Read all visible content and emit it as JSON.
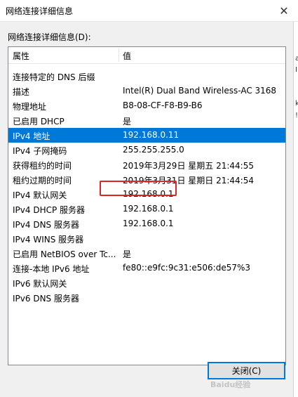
{
  "window": {
    "title": "网络连接详细信息",
    "close_glyph": "✕"
  },
  "section_label": "网络连接详细信息(D):",
  "table": {
    "columns": [
      "属性",
      "值"
    ],
    "rows": [
      {
        "property": "连接特定的 DNS 后缀",
        "value": ""
      },
      {
        "property": "描述",
        "value": "Intel(R) Dual Band Wireless-AC 3168"
      },
      {
        "property": "物理地址",
        "value": "B8-08-CF-F8-B9-B6"
      },
      {
        "property": "已启用 DHCP",
        "value": "是"
      },
      {
        "property": "IPv4 地址",
        "value": "192.168.0.11",
        "selected": true
      },
      {
        "property": "IPv4 子网掩码",
        "value": "255.255.255.0"
      },
      {
        "property": "获得租约的时间",
        "value": "2019年3月29日 星期五 21:44:55"
      },
      {
        "property": "租约过期的时间",
        "value": "2019年3月31日 星期日 21:44:54"
      },
      {
        "property": "IPv4 默认网关",
        "value": "192.168.0.1",
        "highlighted": true
      },
      {
        "property": "IPv4 DHCP 服务器",
        "value": "192.168.0.1"
      },
      {
        "property": "IPv4 DNS 服务器",
        "value": "192.168.0.1"
      },
      {
        "property": "IPv4 WINS 服务器",
        "value": ""
      },
      {
        "property": "已启用 NetBIOS over Tc...",
        "value": "是"
      },
      {
        "property": "连接-本地 IPv6 地址",
        "value": "fe80::e9fc:9c31:e506:de57%3"
      },
      {
        "property": "IPv6 默认网关",
        "value": ""
      },
      {
        "property": "IPv6 DNS 服务器",
        "value": ""
      }
    ]
  },
  "close_button_label": "关闭(C)",
  "watermark": "Baidu经验",
  "right_strip_glyphs": [
    "a",
    "I",
    "k",
    "!"
  ],
  "colors": {
    "selection": "#0078d7",
    "highlight_box": "#e02424"
  }
}
